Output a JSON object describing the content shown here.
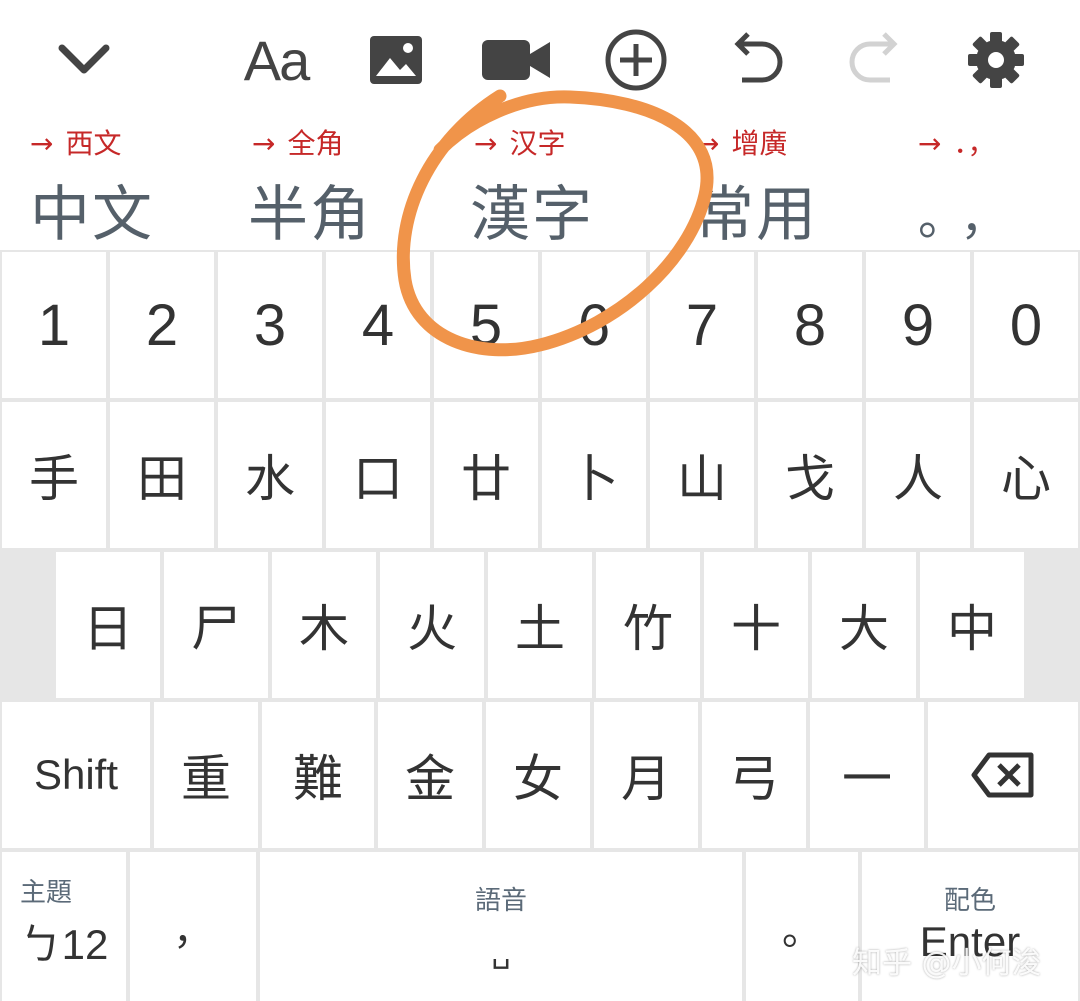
{
  "toolbar": {
    "collapse_icon": "chevron-down-icon",
    "font_label": "Aa",
    "image_icon": "image-icon",
    "video_icon": "video-camera-icon",
    "add_icon": "add-circle-icon",
    "undo_icon": "undo-icon",
    "redo_icon": "redo-icon",
    "settings_icon": "gear-icon"
  },
  "modes": [
    {
      "hint": "西文",
      "label": "中文"
    },
    {
      "hint": "全角",
      "label": "半角"
    },
    {
      "hint": "汉字",
      "label": "漢字"
    },
    {
      "hint": "增廣",
      "label": "常用"
    },
    {
      "hint": "．，",
      "label": "。，"
    }
  ],
  "hint_arrow": "→",
  "keys": {
    "numbers": [
      "1",
      "2",
      "3",
      "4",
      "5",
      "6",
      "7",
      "8",
      "9",
      "0"
    ],
    "row1": [
      "手",
      "田",
      "水",
      "口",
      "廿",
      "卜",
      "山",
      "戈",
      "人",
      "心"
    ],
    "row2": [
      "日",
      "尸",
      "木",
      "火",
      "土",
      "竹",
      "十",
      "大",
      "中"
    ],
    "row3": [
      "重",
      "難",
      "金",
      "女",
      "月",
      "弓",
      "一"
    ],
    "shift": "Shift",
    "backspace_icon": "backspace-icon",
    "theme_sub": "主題",
    "switch_label": "ㄅ12",
    "comma": "，",
    "voice_sub": "語音",
    "space_symbol": "␣",
    "period": "。",
    "color_sub": "配色",
    "enter": "Enter"
  },
  "annotation": {
    "color": "#f0944a"
  },
  "watermark": "知乎 @小何浚"
}
